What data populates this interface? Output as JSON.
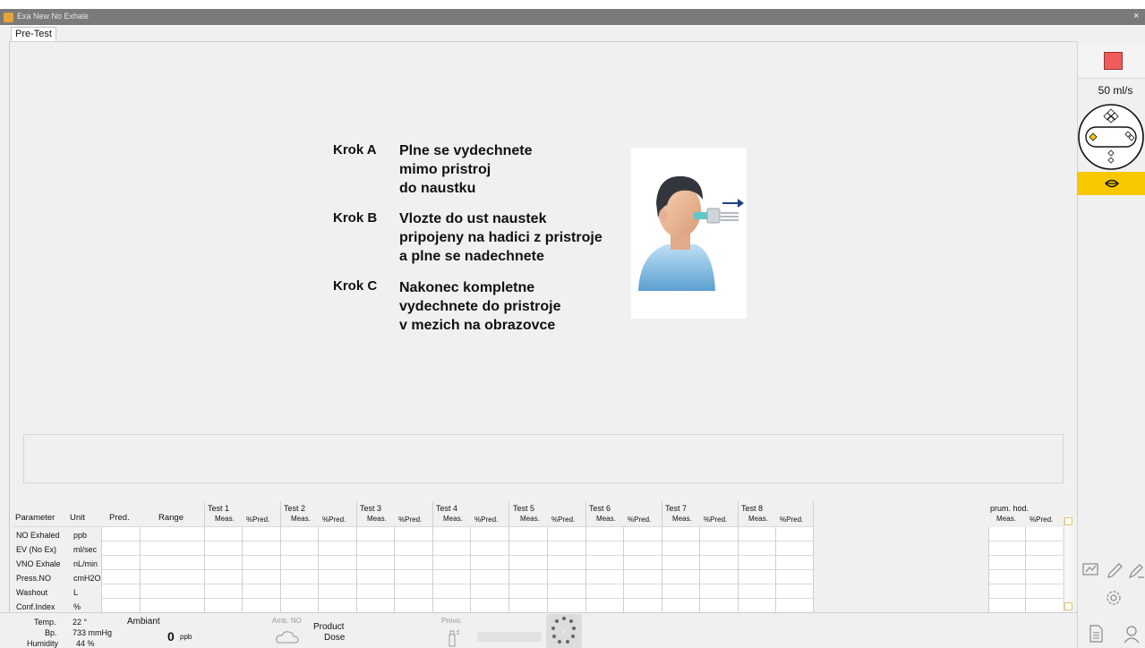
{
  "window": {
    "title": "Exa New No Exhale",
    "close": "×"
  },
  "tabs": [
    {
      "label": "Pre-Test"
    }
  ],
  "instructions": {
    "steps": [
      {
        "label": "Krok A",
        "lines": [
          "Plne se vydechnete",
          "mimo pristroj",
          "do naustku"
        ]
      },
      {
        "label": "Krok B",
        "lines": [
          "Vlozte do ust naustek",
          "pripojeny na hadici z pristroje",
          "a plne se nadechnete"
        ]
      },
      {
        "label": "Krok C",
        "lines": [
          "Nakonec kompletne",
          "vydechnete do pristroje",
          "v mezich na obrazovce"
        ]
      }
    ]
  },
  "right_panel": {
    "flow": "50 ml/s",
    "icons": [
      "stop-icon",
      "breath-dial-icon",
      "lips-icon",
      "compare-icon",
      "pen-icon",
      "sign-icon",
      "settings-icon",
      "report-icon",
      "patient-icon"
    ],
    "accent": "#f7c700",
    "stop_color": "#ee5c5c"
  },
  "table": {
    "headers": {
      "parameter": "Parameter",
      "unit": "Unit",
      "pred": "Pred.",
      "range": "Range"
    },
    "tests": [
      "Test 1",
      "Test 2",
      "Test 3",
      "Test 4",
      "Test 5",
      "Test 6",
      "Test 7",
      "Test 8"
    ],
    "sub": {
      "meas": "Meas.",
      "pred": "%Pred."
    },
    "average": "prum. hod.",
    "rows": [
      {
        "param": "NO Exhaled",
        "unit": "ppb"
      },
      {
        "param": "EV (No Ex)",
        "unit": "ml/sec"
      },
      {
        "param": "VNO Exhale",
        "unit": "nL/min"
      },
      {
        "param": "Press.NO",
        "unit": "cmH2O"
      },
      {
        "param": "Washout",
        "unit": "L"
      },
      {
        "param": "Conf.Index",
        "unit": "%"
      }
    ]
  },
  "status": {
    "temp_label": "Temp.",
    "temp_value": "22 °",
    "bp_label": "Bp.",
    "bp_value": "733 mmHg",
    "humidity_label": "Humidity",
    "humidity_value": "44 %",
    "ambient_label": "Ambiant",
    "ambient_value": "0",
    "ambient_unit": "ppb",
    "amb_no": "Amb. NO",
    "product": "Product",
    "dose": "Dose",
    "provo": "Provo."
  }
}
